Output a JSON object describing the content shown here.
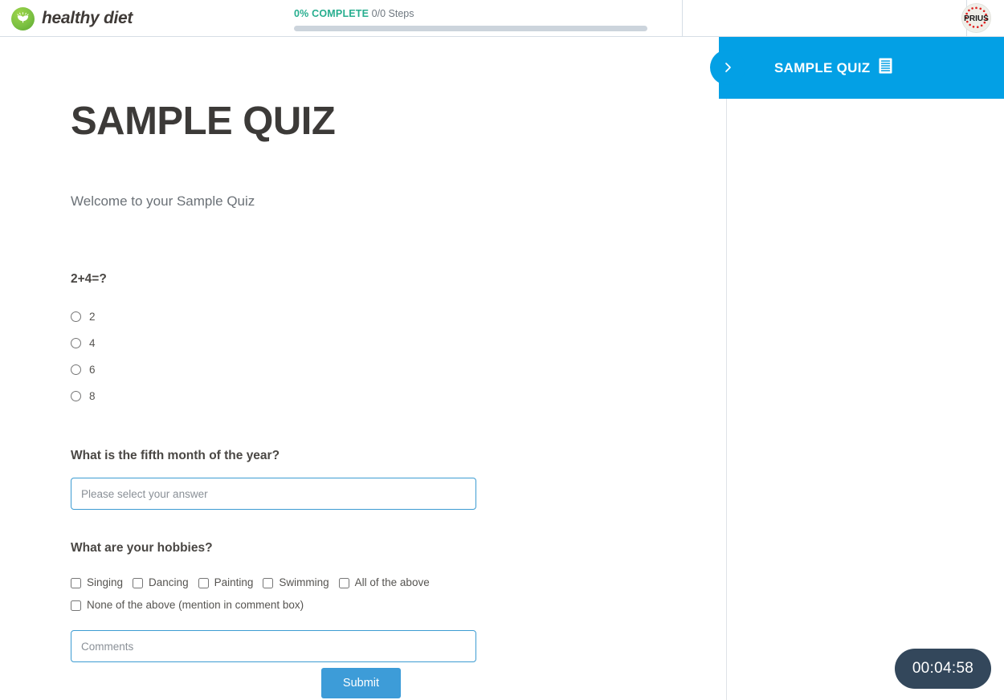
{
  "header": {
    "brand_name": "healthy diet",
    "brand_icon": "leaf-sprout-icon",
    "progress": {
      "percent_label": "0% COMPLETE",
      "steps_label": "0/0 Steps",
      "percent_value": 0,
      "fill_color": "#27ae8f",
      "track_color": "#ccd4dc"
    },
    "avatar_label": "PRIUS"
  },
  "main": {
    "title": "SAMPLE QUIZ",
    "welcome": "Welcome to your Sample Quiz",
    "questions": [
      {
        "prompt": "2+4=?",
        "type": "radio",
        "options": [
          "2",
          "4",
          "6",
          "8"
        ]
      },
      {
        "prompt": "What is the fifth month of the year?",
        "type": "text",
        "value": "",
        "placeholder": "Please select your answer"
      },
      {
        "prompt": "What are your hobbies?",
        "type": "checkbox",
        "options": [
          "Singing",
          "Dancing",
          "Painting",
          "Swimming",
          "All of the above",
          "None of the above (mention in comment box)"
        ],
        "comment": {
          "value": "",
          "placeholder": "Comments"
        }
      }
    ],
    "submit_label": "Submit",
    "submit_color": "#3d9cd8"
  },
  "right_panel": {
    "tab_title": "SAMPLE QUIZ",
    "tab_color": "#03a0e5",
    "tab_icon": "document-lines-icon",
    "expand_icon": "chevron-right-icon"
  },
  "timer": {
    "value": "00:04:58",
    "background": "#33475b"
  }
}
